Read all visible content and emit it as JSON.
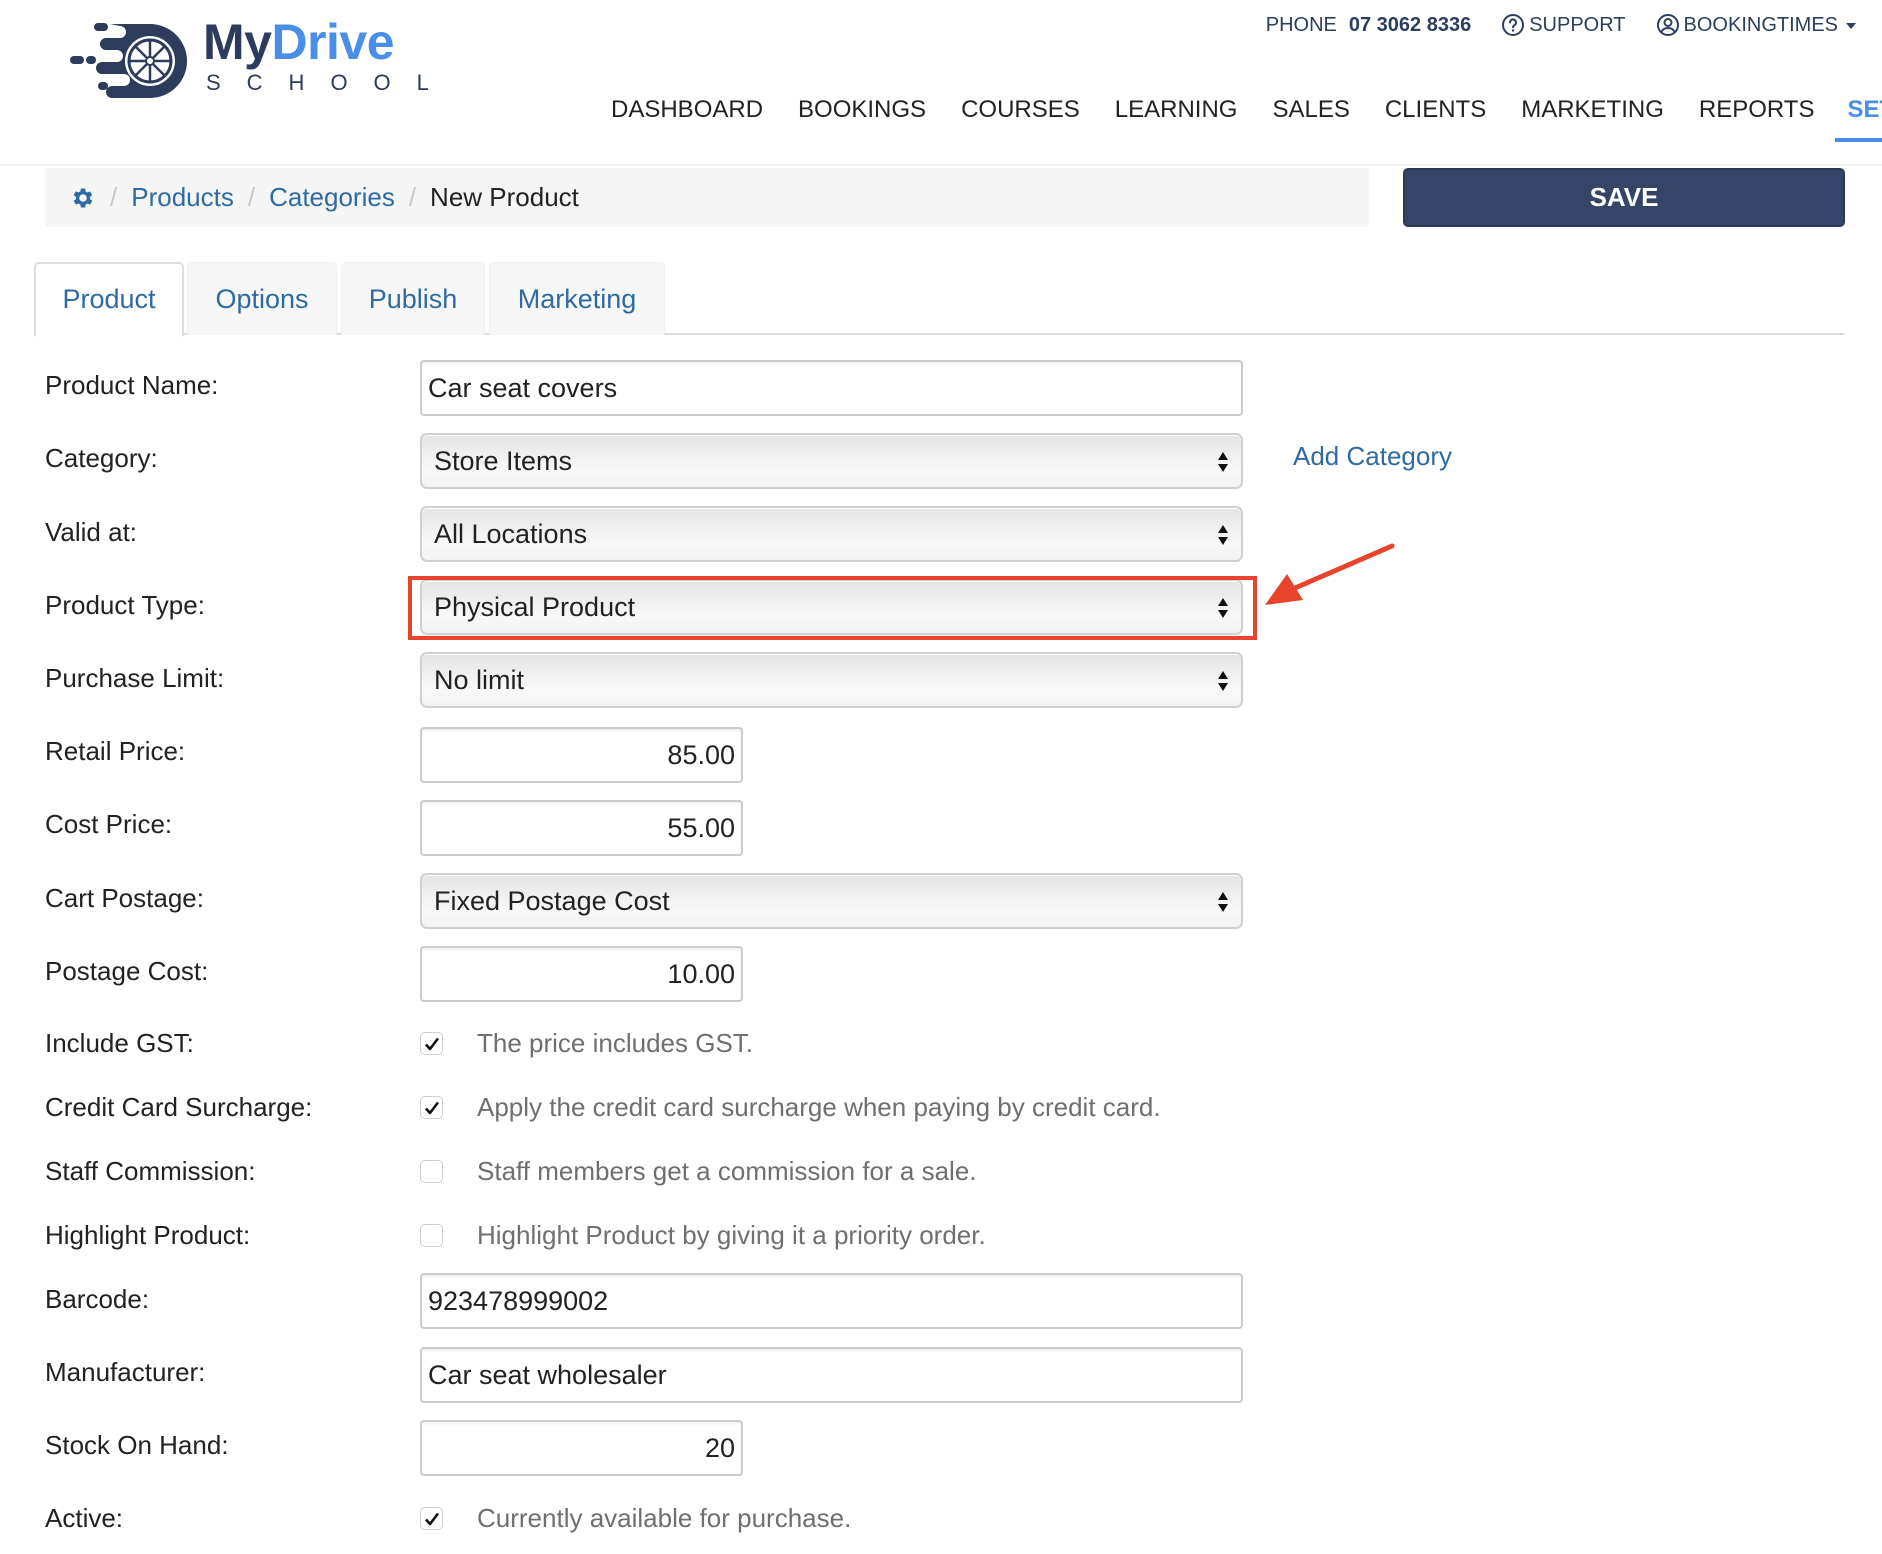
{
  "brand": {
    "name_part1": "My",
    "name_part2": "Drive",
    "subtitle": "SCHOOL",
    "colors": {
      "navy": "#2d3b5c",
      "blue": "#4a8fe7"
    }
  },
  "topbar": {
    "phone_label": "PHONE",
    "phone_number": "07 3062 8336",
    "support_label": "SUPPORT",
    "support_icon": "question-circle-icon",
    "account_label": "BOOKINGTIMES",
    "account_icon": "user-circle-icon"
  },
  "nav": {
    "items": [
      {
        "label": "DASHBOARD"
      },
      {
        "label": "BOOKINGS"
      },
      {
        "label": "COURSES"
      },
      {
        "label": "LEARNING"
      },
      {
        "label": "SALES"
      },
      {
        "label": "CLIENTS"
      },
      {
        "label": "MARKETING"
      },
      {
        "label": "REPORTS"
      },
      {
        "label": "SETUP",
        "active": true
      }
    ],
    "active_color": "#4a8fe7"
  },
  "breadcrumb": {
    "icon": "gear-icon",
    "items": [
      "Products",
      "Categories"
    ],
    "current": "New Product"
  },
  "toolbar": {
    "save_label": "SAVE"
  },
  "tabs": [
    {
      "label": "Product",
      "active": true
    },
    {
      "label": "Options"
    },
    {
      "label": "Publish"
    },
    {
      "label": "Marketing"
    }
  ],
  "form": {
    "product_name": {
      "label": "Product Name:",
      "value": "Car seat covers"
    },
    "category": {
      "label": "Category:",
      "value": "Store Items",
      "add_link": "Add Category"
    },
    "valid_at": {
      "label": "Valid at:",
      "value": "All Locations"
    },
    "product_type": {
      "label": "Product Type:",
      "value": "Physical Product",
      "highlighted": true
    },
    "purchase_limit": {
      "label": "Purchase Limit:",
      "value": "No limit"
    },
    "retail_price": {
      "label": "Retail Price:",
      "value": "85.00"
    },
    "cost_price": {
      "label": "Cost Price:",
      "value": "55.00"
    },
    "cart_postage": {
      "label": "Cart Postage:",
      "value": "Fixed Postage Cost"
    },
    "postage_cost": {
      "label": "Postage Cost:",
      "value": "10.00"
    },
    "include_gst": {
      "label": "Include GST:",
      "checked": true,
      "text": "The price includes GST."
    },
    "cc_surcharge": {
      "label": "Credit Card Surcharge:",
      "checked": true,
      "text": "Apply the credit card surcharge when paying by credit card."
    },
    "staff_commission": {
      "label": "Staff Commission:",
      "checked": false,
      "text": "Staff members get a commission for a sale."
    },
    "highlight_product": {
      "label": "Highlight Product:",
      "checked": false,
      "text": "Highlight Product by giving it a priority order."
    },
    "barcode": {
      "label": "Barcode:",
      "value": "923478999002"
    },
    "manufacturer": {
      "label": "Manufacturer:",
      "value": "Car seat wholesaler"
    },
    "stock_on_hand": {
      "label": "Stock On Hand:",
      "value": "20"
    },
    "active": {
      "label": "Active:",
      "checked": true,
      "text": "Currently available for purchase."
    }
  },
  "annotation": {
    "color": "#e8432b"
  }
}
